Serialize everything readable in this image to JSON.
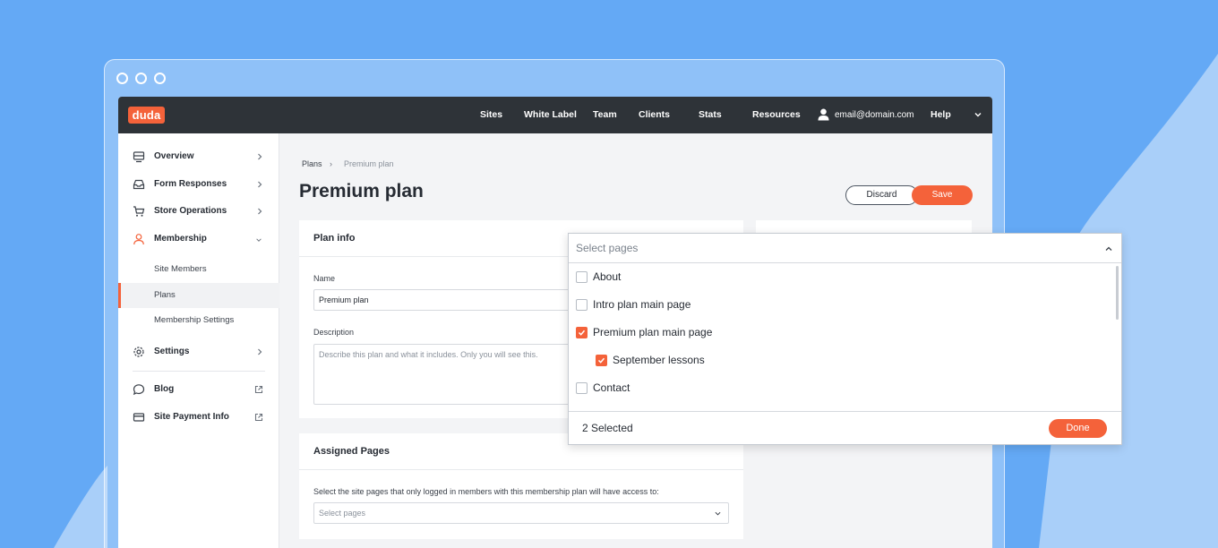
{
  "colors": {
    "background": "#64a9f5",
    "accent": "#f4623a",
    "topbar": "#2e3338"
  },
  "brand": {
    "logo_text": "duda"
  },
  "topnav": {
    "items": [
      "Sites",
      "White Label",
      "Team",
      "Clients",
      "Stats",
      "Resources"
    ],
    "user_email": "email@domain.com",
    "help": "Help",
    "icons": {
      "user": "user-icon",
      "menu": "chevron-down-icon"
    }
  },
  "sidebar": {
    "items": [
      {
        "label": "Overview",
        "icon": "monitor-icon"
      },
      {
        "label": "Form Responses",
        "icon": "inbox-icon"
      },
      {
        "label": "Store Operations",
        "icon": "cart-icon"
      },
      {
        "label": "Membership",
        "icon": "person-icon"
      }
    ],
    "membership_subitems": [
      "Site Members",
      "Plans",
      "Membership Settings"
    ],
    "active_subitem": "Plans",
    "settings": {
      "label": "Settings",
      "icon": "gear-icon"
    },
    "links": [
      {
        "label": "Blog",
        "icon": "chat-bubble-icon"
      },
      {
        "label": "Site Payment Info",
        "icon": "credit-card-icon"
      }
    ]
  },
  "breadcrumb": {
    "parent": "Plans",
    "current": "Premium plan",
    "separator": "›"
  },
  "page": {
    "title": "Premium plan",
    "discard_label": "Discard",
    "save_label": "Save"
  },
  "plan_info": {
    "heading": "Plan info",
    "name_label": "Name",
    "name_value": "Premium plan",
    "description_label": "Description",
    "description_placeholder": "Describe this plan and what it includes. Only you will see this."
  },
  "assigned_pages": {
    "heading": "Assigned Pages",
    "instructions": "Select the site pages that only logged in members with this membership plan will have access to:",
    "select_placeholder": "Select pages"
  },
  "page_dropdown": {
    "placeholder": "Select pages",
    "options": [
      {
        "label": "About",
        "checked": false,
        "indent": 0
      },
      {
        "label": "Intro plan main page",
        "checked": false,
        "indent": 0
      },
      {
        "label": "Premium plan main page",
        "checked": true,
        "indent": 0
      },
      {
        "label": "September lessons",
        "checked": true,
        "indent": 1
      },
      {
        "label": "Contact",
        "checked": false,
        "indent": 0
      }
    ],
    "selected_count_text": "2 Selected",
    "done_label": "Done"
  }
}
